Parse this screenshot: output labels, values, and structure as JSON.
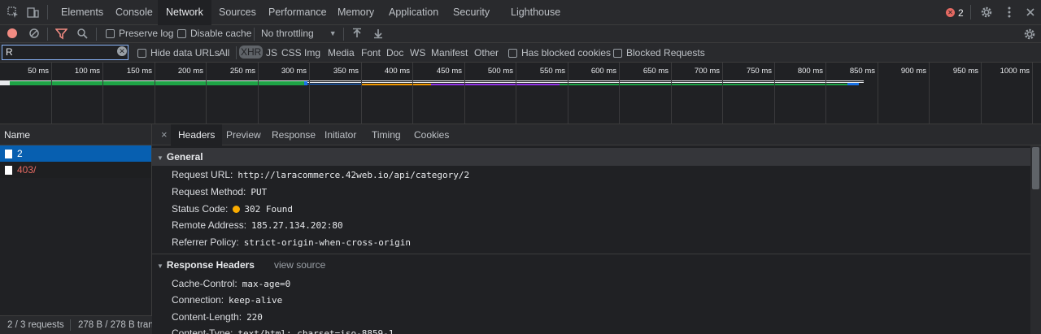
{
  "topbar": {
    "tabs": [
      "Elements",
      "Console",
      "Network",
      "Sources",
      "Performance",
      "Memory",
      "Application",
      "Security",
      "Lighthouse"
    ],
    "active_tab": "Network",
    "error_count": "2",
    "icons": [
      "inspect-icon",
      "device-toggle-icon",
      "settings-icon",
      "more-icon"
    ]
  },
  "toolbar": {
    "preserve_log": "Preserve log",
    "disable_cache": "Disable cache",
    "throttling": "No throttling",
    "icons": [
      "record-icon",
      "clear-icon",
      "filter-icon",
      "search-icon",
      "import-icon",
      "export-icon",
      "network-settings-icon"
    ]
  },
  "filter": {
    "value": "R",
    "hide_data_urls": "Hide data URLs",
    "types": [
      "All",
      "XHR",
      "JS",
      "CSS",
      "Img",
      "Media",
      "Font",
      "Doc",
      "WS",
      "Manifest",
      "Other"
    ],
    "selected_type": "XHR",
    "has_blocked_cookies": "Has blocked cookies",
    "blocked_requests": "Blocked Requests"
  },
  "timeline": {
    "ticks": [
      "50 ms",
      "100 ms",
      "150 ms",
      "200 ms",
      "250 ms",
      "300 ms",
      "350 ms",
      "400 ms",
      "450 ms",
      "500 ms",
      "550 ms",
      "600 ms",
      "650 ms",
      "700 ms",
      "750 ms",
      "800 ms",
      "850 ms",
      "900 ms",
      "950 ms",
      "1000 ms"
    ]
  },
  "requests": {
    "header": "Name",
    "rows": [
      {
        "name": "2",
        "selected": true,
        "error": false
      },
      {
        "name": "403/",
        "selected": false,
        "error": true
      }
    ],
    "status_count": "2 / 3 requests",
    "status_size": "278 B / 278 B tran"
  },
  "details": {
    "tabs": [
      "Headers",
      "Preview",
      "Response",
      "Initiator",
      "Timing",
      "Cookies"
    ],
    "active_tab": "Headers",
    "general": {
      "title": "General",
      "request_url_label": "Request URL:",
      "request_url": "http://laracommerce.42web.io/api/category/2",
      "method_label": "Request Method:",
      "method": "PUT",
      "status_label": "Status Code:",
      "status": "302 Found",
      "remote_label": "Remote Address:",
      "remote": "185.27.134.202:80",
      "referrer_label": "Referrer Policy:",
      "referrer": "strict-origin-when-cross-origin"
    },
    "response_headers": {
      "title": "Response Headers",
      "view_source": "view source",
      "cache_control_label": "Cache-Control:",
      "cache_control": "max-age=0",
      "connection_label": "Connection:",
      "connection": "keep-alive",
      "content_length_label": "Content-Length:",
      "content_length": "220",
      "content_type_label": "Content-Type:",
      "content_type": "text/html; charset=iso-8859-1"
    }
  },
  "colors": {
    "accent": "#8ab4f8",
    "selected_row": "#075fb0",
    "error_text": "#e46962",
    "status_warning": "#f9ab00"
  }
}
